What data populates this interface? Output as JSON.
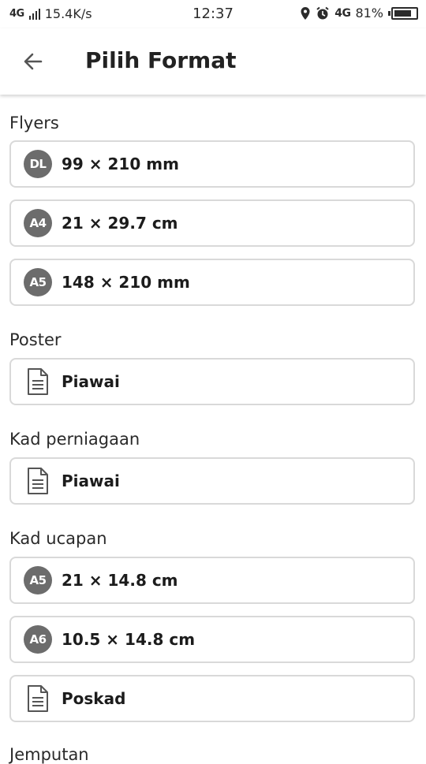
{
  "status_bar": {
    "network_label": "4G",
    "speed": "15.4K/s",
    "time": "12:37",
    "net_type": "4G",
    "battery_percent": "81%",
    "battery_level": 0.81
  },
  "header": {
    "title": "Pilih Format"
  },
  "sections": [
    {
      "title": "Flyers",
      "items": [
        {
          "badge": "DL",
          "label": "99 × 210 mm"
        },
        {
          "badge": "A4",
          "label": "21 × 29.7 cm"
        },
        {
          "badge": "A5",
          "label": "148 × 210 mm"
        }
      ]
    },
    {
      "title": "Poster",
      "items": [
        {
          "icon": "document-icon",
          "label": "Piawai"
        }
      ]
    },
    {
      "title": "Kad perniagaan",
      "items": [
        {
          "icon": "document-icon",
          "label": "Piawai"
        }
      ]
    },
    {
      "title": "Kad ucapan",
      "items": [
        {
          "badge": "A5",
          "label": "21 × 14.8 cm"
        },
        {
          "badge": "A6",
          "label": "10.5 × 14.8 cm"
        },
        {
          "icon": "document-icon",
          "label": "Poskad"
        }
      ]
    },
    {
      "title": "Jemputan",
      "items": []
    }
  ]
}
